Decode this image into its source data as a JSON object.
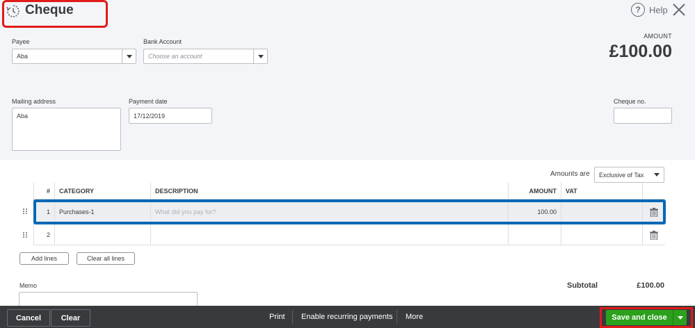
{
  "header": {
    "title": "Cheque",
    "help_label": "Help"
  },
  "form": {
    "payee_label": "Payee",
    "payee_value": "Aba",
    "bank_account_label": "Bank Account",
    "bank_account_placeholder": "Choose an account",
    "amount_label": "AMOUNT",
    "amount_value": "£100.00",
    "mailing_address_label": "Mailing address",
    "mailing_address_value": "Aba",
    "payment_date_label": "Payment date",
    "payment_date_value": "17/12/2019",
    "cheque_no_label": "Cheque no.",
    "cheque_no_value": ""
  },
  "amounts_are": {
    "label": "Amounts are",
    "selected": "Exclusive of Tax"
  },
  "table": {
    "columns": [
      "#",
      "CATEGORY",
      "DESCRIPTION",
      "AMOUNT",
      "VAT"
    ],
    "rows": [
      {
        "num": "1",
        "category": "Purchases-1",
        "description_placeholder": "What did you pay for?",
        "amount": "100.00",
        "vat": ""
      },
      {
        "num": "2",
        "category": "",
        "description_placeholder": "",
        "amount": "",
        "vat": ""
      }
    ]
  },
  "actions": {
    "add_lines": "Add lines",
    "clear_all_lines": "Clear all lines"
  },
  "memo": {
    "label": "Memo"
  },
  "totals": {
    "subtotal_label": "Subtotal",
    "subtotal_value": "£100.00"
  },
  "footer": {
    "cancel": "Cancel",
    "clear": "Clear",
    "print": "Print",
    "recurring": "Enable recurring payments",
    "more": "More",
    "save_close": "Save and close"
  },
  "colors": {
    "primary_green": "#2ca01c",
    "highlight_red": "#e11a1a",
    "highlight_blue": "#0068b6",
    "footer_bg": "#393a3d"
  }
}
